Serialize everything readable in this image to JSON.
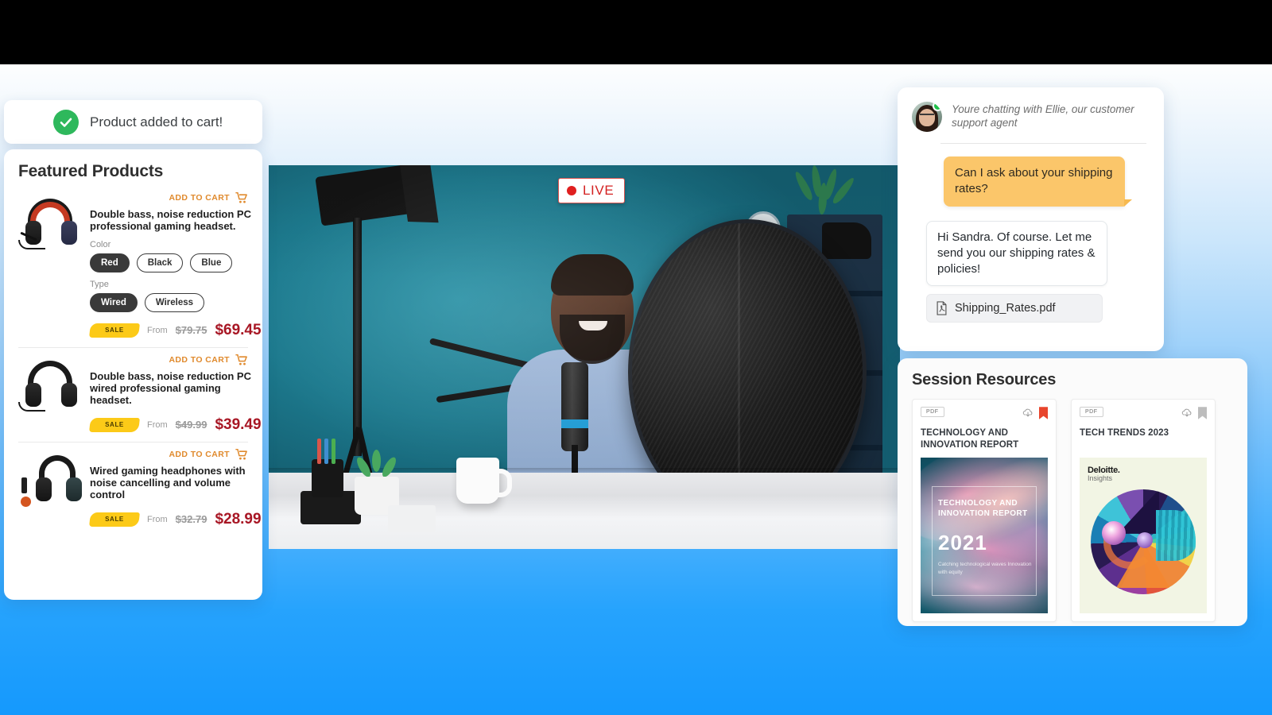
{
  "toast": {
    "icon": "check-circle-icon",
    "message": "Product added to cart!"
  },
  "products_panel": {
    "title": "Featured Products",
    "add_to_cart_label": "ADD TO CART",
    "cart_icon": "shopping-cart-icon",
    "sale_label": "SALE",
    "from_label": "From",
    "items": [
      {
        "title": "Double bass, noise reduction PC professional gaming headset.",
        "options": [
          {
            "label": "Color",
            "values": [
              "Red",
              "Black",
              "Blue"
            ],
            "selected": "Red"
          },
          {
            "label": "Type",
            "values": [
              "Wired",
              "Wireless"
            ],
            "selected": "Wired"
          }
        ],
        "old_price": "$79.75",
        "price": "$69.45"
      },
      {
        "title": "Double bass, noise reduction PC wired professional gaming headset.",
        "options": [],
        "old_price": "$49.99",
        "price": "$39.49"
      },
      {
        "title": "Wired gaming headphones with noise cancelling and volume control",
        "options": [],
        "old_price": "$32.79",
        "price": "$28.99"
      }
    ]
  },
  "video": {
    "live_badge": "LIVE",
    "live_dot_color": "#e01f1f"
  },
  "chat": {
    "header": "Youre chatting with Ellie, our customer support agent",
    "online_status": "online",
    "messages": [
      {
        "from": "customer",
        "text": "Can I ask about your shipping rates?"
      },
      {
        "from": "agent",
        "text": "Hi Sandra. Of course. Let me send you our shipping rates & policies!"
      }
    ],
    "attachment": {
      "icon": "pdf-file-icon",
      "name": "Shipping_Rates.pdf"
    }
  },
  "resources": {
    "title": "Session Resources",
    "cards": [
      {
        "type_badge": "PDF",
        "title": "TECHNOLOGY AND INNOVATION REPORT",
        "download_icon": "cloud-download-icon",
        "bookmark_icon": "bookmark-icon",
        "bookmarked": true,
        "bookmark_color": "#e8452c",
        "cover": {
          "line1": "TECHNOLOGY AND INNOVATION REPORT",
          "year": "2021",
          "subtitle": "Catching technological waves Innovation with equity"
        }
      },
      {
        "type_badge": "PDF",
        "title": "TECH TRENDS 2023",
        "download_icon": "cloud-download-icon",
        "bookmark_icon": "bookmark-icon",
        "bookmarked": false,
        "bookmark_color": "#bdbdbd",
        "cover": {
          "brand": "Deloitte.",
          "brand_sub": "Insights"
        }
      }
    ]
  },
  "theme": {
    "accent_orange": "#e08a2d",
    "price_red": "#a81725",
    "sale_yellow": "#fcca18",
    "bubble_yellow": "#fbc66a",
    "success_green": "#2eb85c",
    "background_blue": "#1599fd"
  }
}
